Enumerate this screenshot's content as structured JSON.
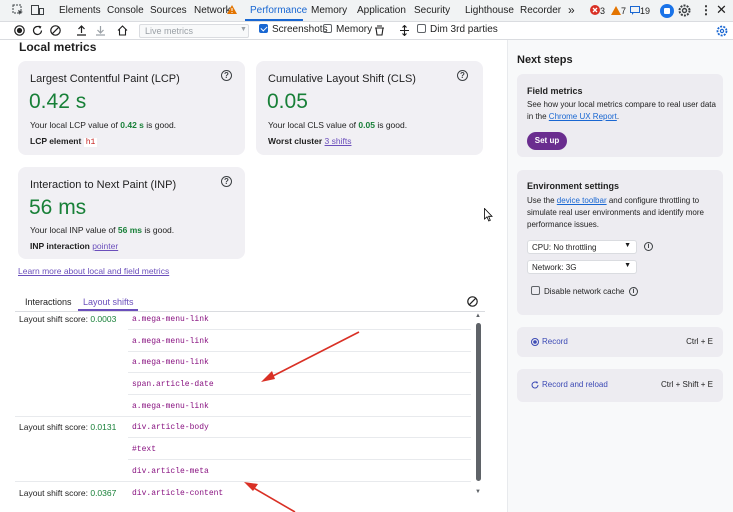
{
  "tabbar": {
    "tabs": [
      "Elements",
      "Console",
      "Sources",
      "Network",
      "Performance",
      "Memory",
      "Application",
      "Security",
      "Lighthouse",
      "Recorder"
    ],
    "active_tab": "Performance",
    "more": "»",
    "errors": "3",
    "warnings": "7",
    "messages": "19"
  },
  "toolbar": {
    "live_metrics_label": "Live metrics",
    "screenshots_label": "Screenshots",
    "memory_label": "Memory",
    "dim_3rd_parties_label": "Dim 3rd parties"
  },
  "main": {
    "section_title": "Local metrics",
    "lcp": {
      "title": "Largest Contentful Paint (LCP)",
      "value": "0.42 s",
      "desc_prefix": "Your local LCP value of ",
      "desc_value": "0.42 s",
      "desc_suffix": " is good.",
      "meta_label": "LCP element",
      "meta_value": "h1"
    },
    "cls": {
      "title": "Cumulative Layout Shift (CLS)",
      "value": "0.05",
      "desc_prefix": "Your local CLS value of ",
      "desc_value": "0.05",
      "desc_suffix": " is good.",
      "meta_label": "Worst cluster",
      "meta_value": "3 shifts"
    },
    "inp": {
      "title": "Interaction to Next Paint (INP)",
      "value": "56 ms",
      "desc_prefix": "Your local INP value of ",
      "desc_value": "56 ms",
      "desc_suffix": " is good.",
      "meta_label": "INP interaction",
      "meta_value": "pointer"
    },
    "learn_more": "Learn more about local and field metrics",
    "subtabs": [
      "Interactions",
      "Layout shifts"
    ],
    "active_subtab": "Layout shifts",
    "score_label": "Layout shift score: ",
    "shift_groups": [
      {
        "score": "0.0003",
        "nodes": [
          "a.mega-menu-link",
          "a.mega-menu-link",
          "a.mega-menu-link",
          "span.article-date",
          "a.mega-menu-link"
        ]
      },
      {
        "score": "0.0131",
        "nodes": [
          "div.article-body",
          "#text",
          "div.article-meta"
        ]
      },
      {
        "score": "0.0367",
        "nodes": [
          "div.article-content"
        ]
      }
    ]
  },
  "sidebar": {
    "title": "Next steps",
    "field": {
      "title": "Field metrics",
      "text_prefix": "See how your local metrics compare to real user data in the ",
      "text_link": "Chrome UX Report",
      "text_suffix": ".",
      "button": "Set up"
    },
    "env": {
      "title": "Environment settings",
      "text_prefix": "Use the ",
      "text_link": "device toolbar",
      "text_suffix": " and configure throttling to simulate real user environments and identify more performance issues.",
      "cpu": "CPU: No throttling",
      "network": "Network: 3G",
      "disable_cache": "Disable network cache"
    },
    "record": {
      "label": "Record",
      "shortcut": "Ctrl + E"
    },
    "record_reload": {
      "label": "Record and reload",
      "shortcut": "Ctrl + Shift + E"
    }
  },
  "colors": {
    "good": "#188038",
    "accent": "#1967d2",
    "card_bg": "#f1f0f4",
    "setup_button": "#6a2d8f",
    "annotation_arrow": "#d93025"
  }
}
